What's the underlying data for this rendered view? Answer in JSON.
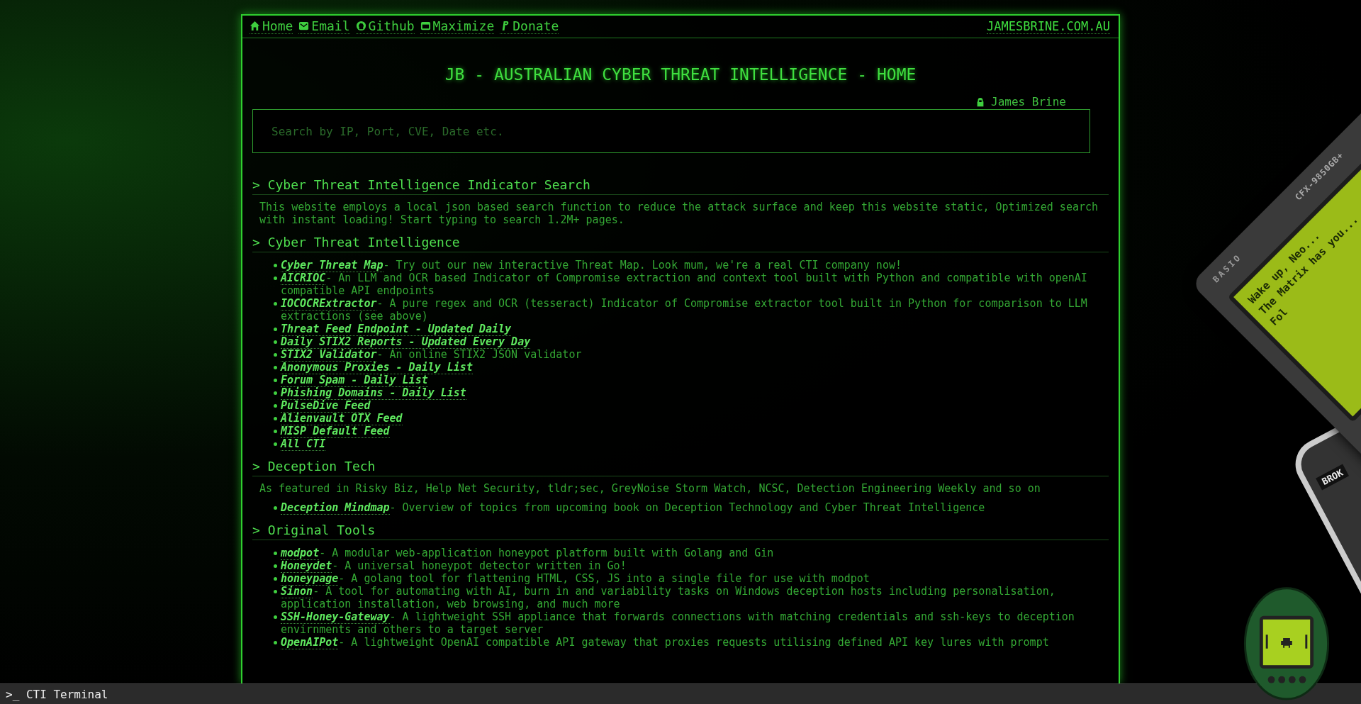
{
  "nav": {
    "links": [
      {
        "kind": "home",
        "label": "Home"
      },
      {
        "kind": "email",
        "label": "Email"
      },
      {
        "kind": "github",
        "label": "Github"
      },
      {
        "kind": "window",
        "label": "Maximize"
      },
      {
        "kind": "paypal",
        "label": "Donate"
      }
    ],
    "site": "JAMESBRINE.COM.AU"
  },
  "title": "JB - AUSTRALIAN CYBER THREAT INTELLIGENCE - HOME",
  "author": "James Brine",
  "search": {
    "placeholder": "Search by IP, Port, CVE, Date etc."
  },
  "sections": [
    {
      "heading": "> Cyber Threat Intelligence Indicator Search",
      "description": "This website employs a local json based search function to reduce the attack surface and keep this website static, Optimized search with instant loading! Start typing to search 1.2M+ pages."
    },
    {
      "heading": "> Cyber Threat Intelligence",
      "items": [
        {
          "link": "Cyber Threat Map",
          "text": "- Try out our new interactive Threat Map. Look mum, we're a real CTI company now!"
        },
        {
          "link": "AICRIOC",
          "text": "- An LLM and OCR based Indicator of Compromise extraction and context tool built with Python and compatible with openAI compatible API endpoints"
        },
        {
          "link": "IOCOCRExtractor",
          "text": "- A pure regex and OCR (tesseract) Indicator of Compromise extractor tool built in Python for comparison to LLM extractions (see above)"
        },
        {
          "link": "Threat Feed Endpoint - Updated Daily"
        },
        {
          "link": "Daily STIX2 Reports - Updated Every Day"
        },
        {
          "link": "STIX2 Validator",
          "text": "- An online STIX2 JSON validator"
        },
        {
          "link": "Anonymous Proxies - Daily List"
        },
        {
          "link": "Forum Spam - Daily List"
        },
        {
          "link": "Phishing Domains - Daily List"
        },
        {
          "link": "PulseDive Feed"
        },
        {
          "link": "Alienvault OTX Feed"
        },
        {
          "link": "MISP Default Feed"
        },
        {
          "link": "All CTI"
        }
      ]
    },
    {
      "heading": "> Deception Tech",
      "description": "As featured in Risky Biz, Help Net Security, tldr;sec, GreyNoise Storm Watch, NCSC, Detection Engineering Weekly and so on",
      "items": [
        {
          "link": "Deception Mindmap",
          "text": "- Overview of topics from upcoming book on Deception Technology and Cyber Threat Intelligence"
        }
      ]
    },
    {
      "heading": "> Original Tools",
      "items": [
        {
          "link": "modpot",
          "text": "- A modular web-application honeypot platform built with Golang and Gin"
        },
        {
          "link": "Honeydet",
          "text": "- A universal honeypot detector written in Go!"
        },
        {
          "link": "honeypage",
          "text": "- A golang tool for flattening HTML, CSS, JS into a single file for use with modpot"
        },
        {
          "link": "Sinon",
          "text": "- A tool for automating with AI, burn in and variability tasks on Windows deception hosts including personalisation, application installation, web browsing, and much more"
        },
        {
          "link": "SSH-Honey-Gateway",
          "text": "- A lightweight SSH appliance that forwards connections with matching credentials and ssh-keys to deception envirnments and others to a target server"
        },
        {
          "link": "OpenAIPot",
          "text": "- A lightweight OpenAI compatible API gateway that proxies requests utilising defined API key lures with prompt"
        }
      ]
    }
  ],
  "calculator": {
    "brand": "BASIO",
    "model": "CFX-9850GB+",
    "screen_lines": [
      "Wake up, Neo...",
      "The Matrix has you...",
      "Fol"
    ]
  },
  "phone": {
    "brand": "BROK"
  },
  "terminal_bar": {
    "prompt": ">_",
    "label": "CTI Terminal"
  }
}
